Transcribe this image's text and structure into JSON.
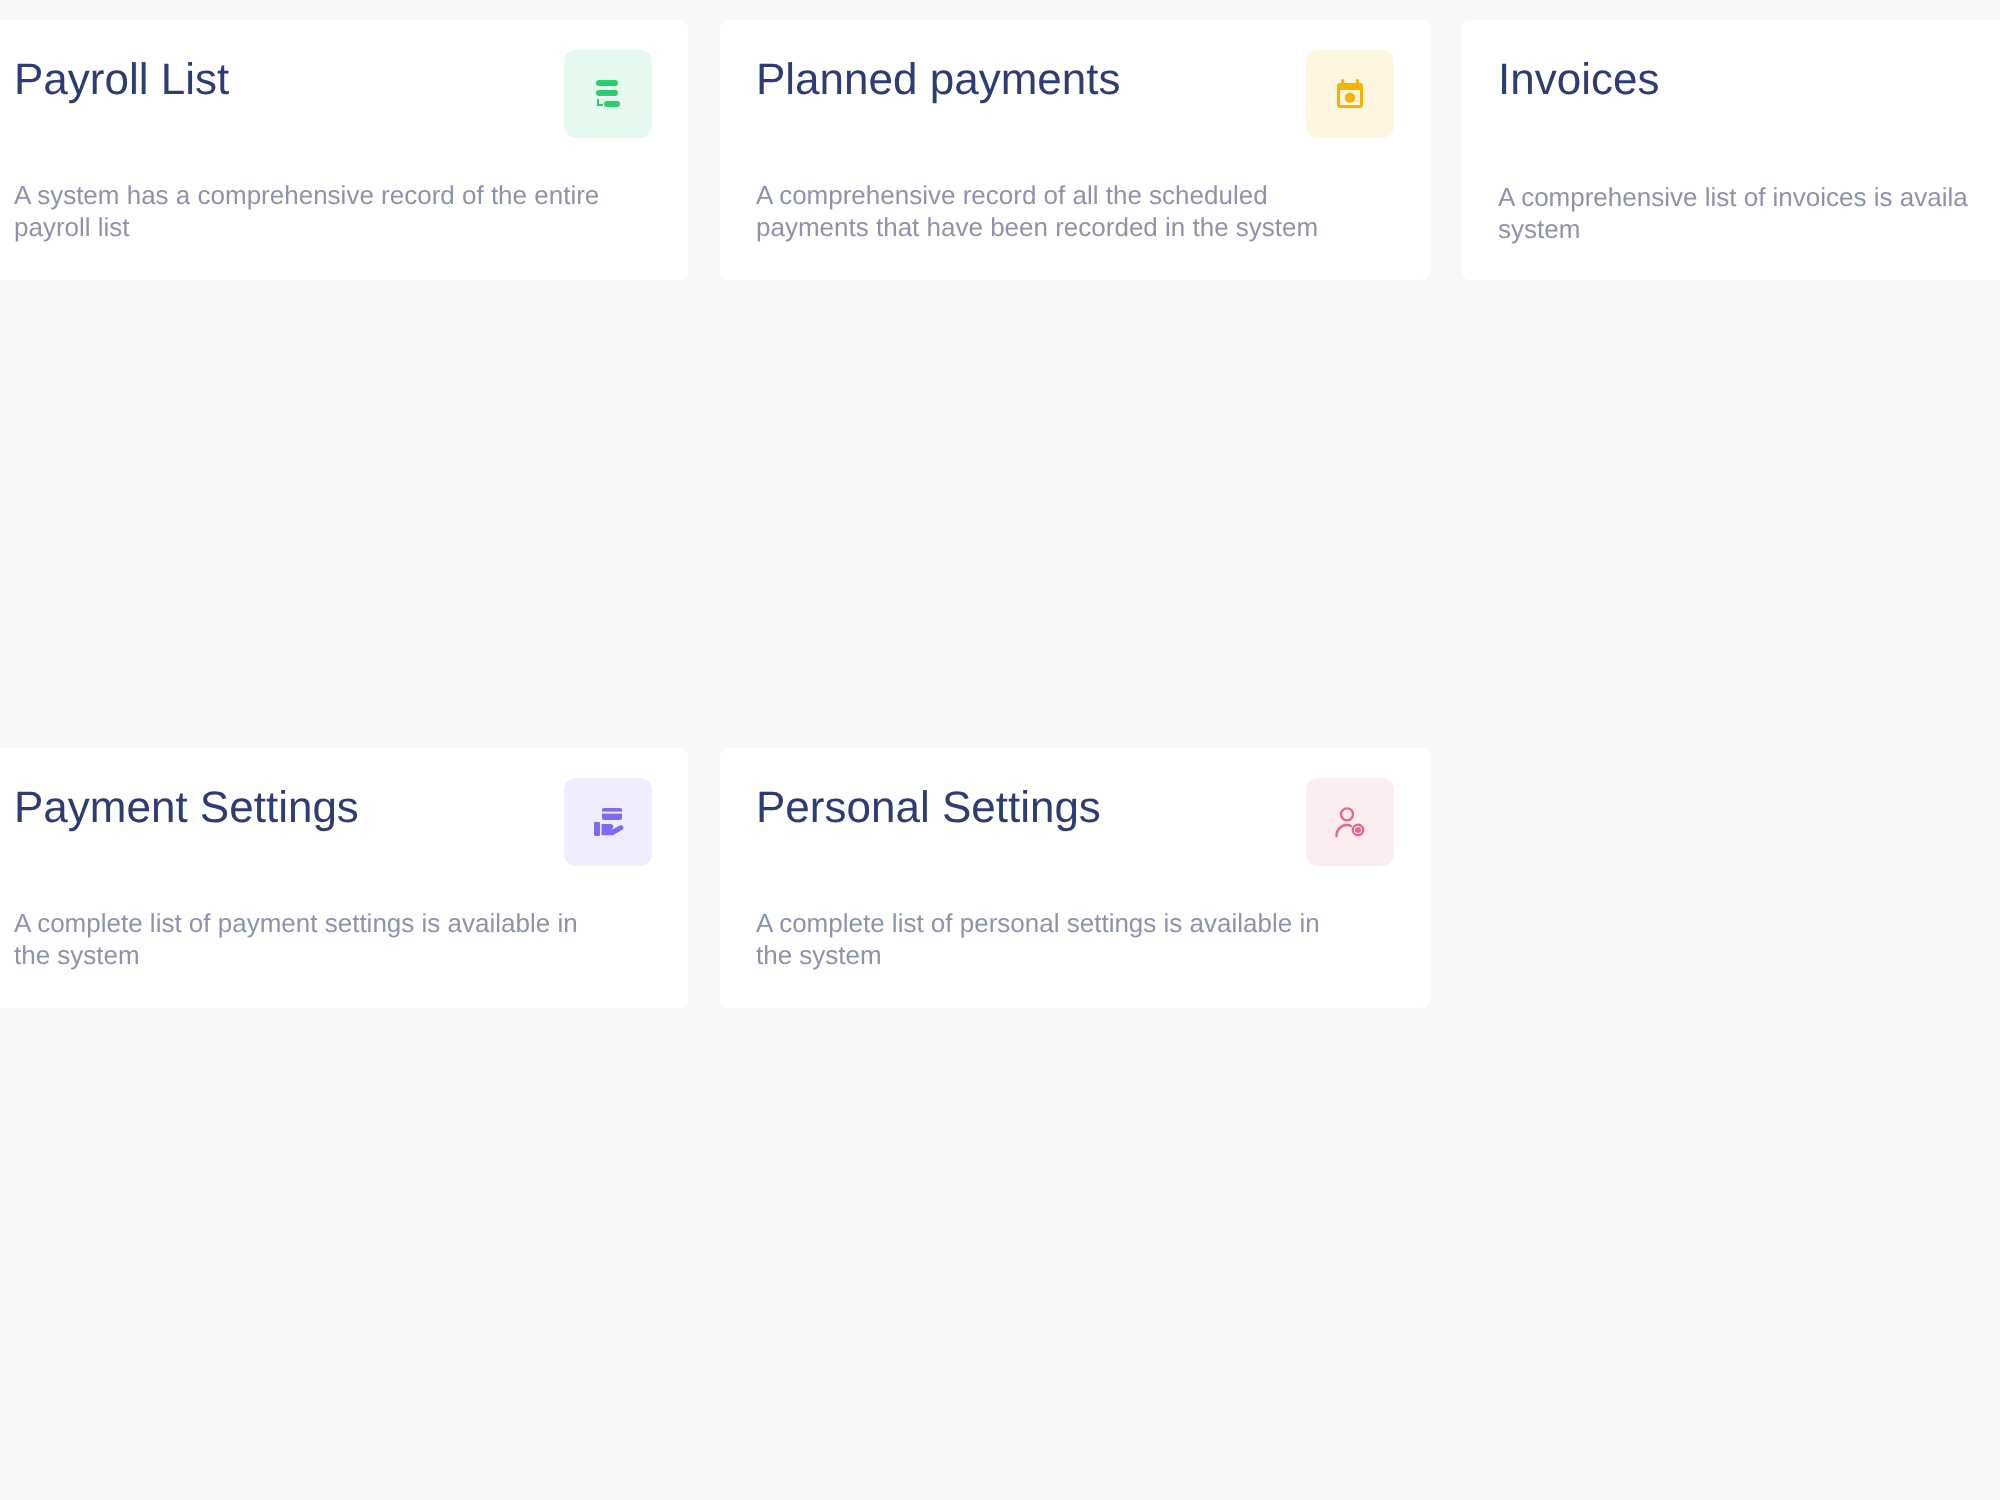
{
  "cards": [
    {
      "title": "Payroll List",
      "description": [
        "A system has a comprehensive record of the entire",
        "payroll list"
      ],
      "color": "#2ecc71"
    },
    {
      "title": "Planned payments",
      "description": [
        "A comprehensive record of all the scheduled",
        "payments that have been recorded in the system"
      ],
      "color": "#f5b400"
    },
    {
      "title": "Invoices",
      "description": [
        "A comprehensive list of invoices is availa",
        "system"
      ]
    },
    {
      "title": "Payment Settings",
      "description": [
        "A complete list of payment settings is available in",
        "the system"
      ],
      "color": "#7c6cf2"
    },
    {
      "title": "Personal Settings",
      "description": [
        "A complete list of personal settings is available in",
        "the system"
      ],
      "color": "#e5698b"
    }
  ]
}
